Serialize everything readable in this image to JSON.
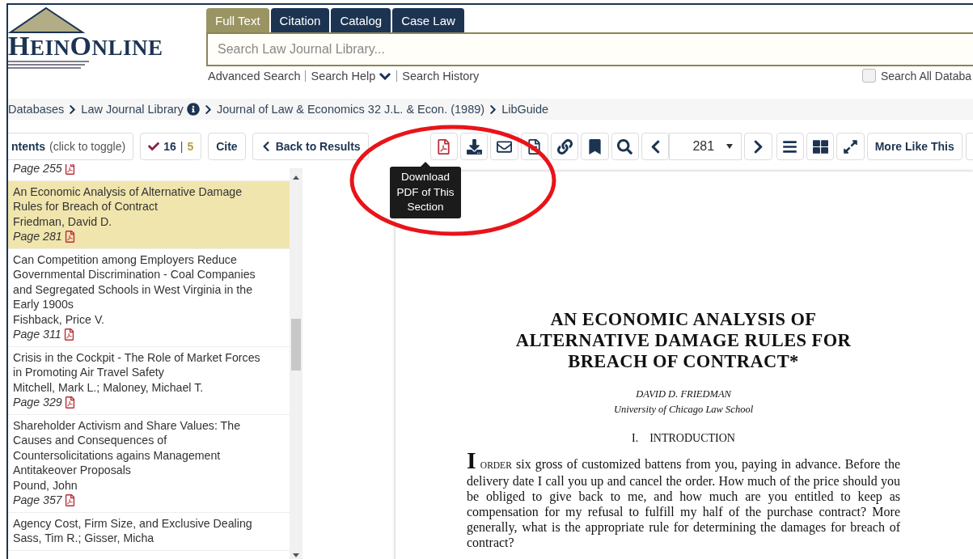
{
  "logo": {
    "first": "HEIN",
    "second": "ONLINE"
  },
  "search_tabs": [
    {
      "label": "Full Text",
      "selected": true
    },
    {
      "label": "Citation",
      "selected": false
    },
    {
      "label": "Catalog",
      "selected": false
    },
    {
      "label": "Case Law",
      "selected": false
    }
  ],
  "search": {
    "placeholder": "Search Law Journal Library..."
  },
  "search_links": [
    "Advanced Search",
    "Search Help",
    "Search History"
  ],
  "search_all": {
    "label": "Search All Databa",
    "checked": false
  },
  "breadcrumb": [
    "Databases",
    "Law Journal Library",
    "Journal of Law & Economics 32 J.L. & Econ. (1989)",
    "LibGuide"
  ],
  "toolbar": {
    "contents_bold": "ntents",
    "contents_hint": "(click to toggle)",
    "marked_count": "16",
    "marked_sep": "|",
    "marked_extra": "5",
    "cite": "Cite",
    "back": "Back to Results",
    "page": "281",
    "more": "More Like This"
  },
  "tooltip": "Download PDF of This Section",
  "toc": [
    {
      "page": "Page 255",
      "selected": false
    },
    {
      "title": "An Economic Analysis of Alternative Damage Rules for Breach of Contract",
      "authors": "Friedman, David D.",
      "page": "Page 281",
      "selected": true
    },
    {
      "title": "Can Competition among Employers Reduce Governmental Discrimination - Coal Companies and Segregated Schools in West Virginia in the Early 1900s",
      "authors": "Fishback, Price V.",
      "page": "Page 311",
      "selected": false
    },
    {
      "title": "Crisis in the Cockpit - The Role of Market Forces in Promoting Air Travel Safety",
      "authors": "Mitchell, Mark L.; Maloney, Michael T.",
      "page": "Page 329",
      "selected": false
    },
    {
      "title": "Shareholder Activism and Share Values: The Causes and Consequences of Countersolicitations agains Management Antitakeover Proposals",
      "authors": "Pound, John",
      "page": "Page 357",
      "selected": false
    },
    {
      "title": "Agency Cost, Firm Size, and Exclusive Dealing",
      "authors": "Sass, Tim R.; Gisser, Micha",
      "selected": false
    }
  ],
  "document": {
    "title_lines": [
      "AN ECONOMIC ANALYSIS OF",
      "ALTERNATIVE DAMAGE RULES FOR",
      "BREACH OF CONTRACT*"
    ],
    "author": "DAVID D. FRIEDMAN",
    "affiliation": "University of Chicago Law School",
    "section_number": "I.",
    "section_title": "INTRODUCTION",
    "drop_cap": "I",
    "lead": "ORDER",
    "body": "six gross of customized battens from you, paying in advance. Before the delivery date I call you up and cancel the order. How much of the price should you be obliged to give back to me, and how much are you entitled to keep as compensation for my refusal to fulfill my half of the purchase contract? More generally, what is the appropriate rule for determining the damages for breach of contract?"
  }
}
